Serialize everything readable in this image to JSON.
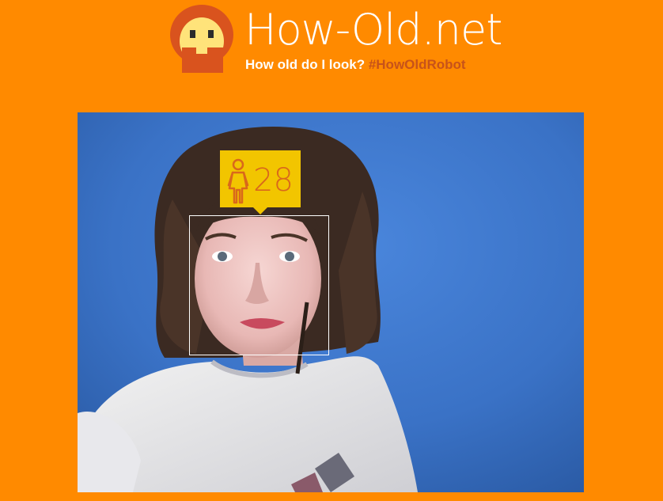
{
  "header": {
    "title": "How-Old.net",
    "tagline": "How old do I look?",
    "hashtag": "#HowOldRobot",
    "logo_icon": "robot-face-logo-icon"
  },
  "photo": {
    "description_icon": "user-photo",
    "face": {
      "gender_icon": "female-icon",
      "age": "28"
    }
  },
  "colors": {
    "background": "#ff8a00",
    "badge": "#f2c500",
    "badge_text": "#d9681b",
    "hashtag": "#c7531a"
  }
}
